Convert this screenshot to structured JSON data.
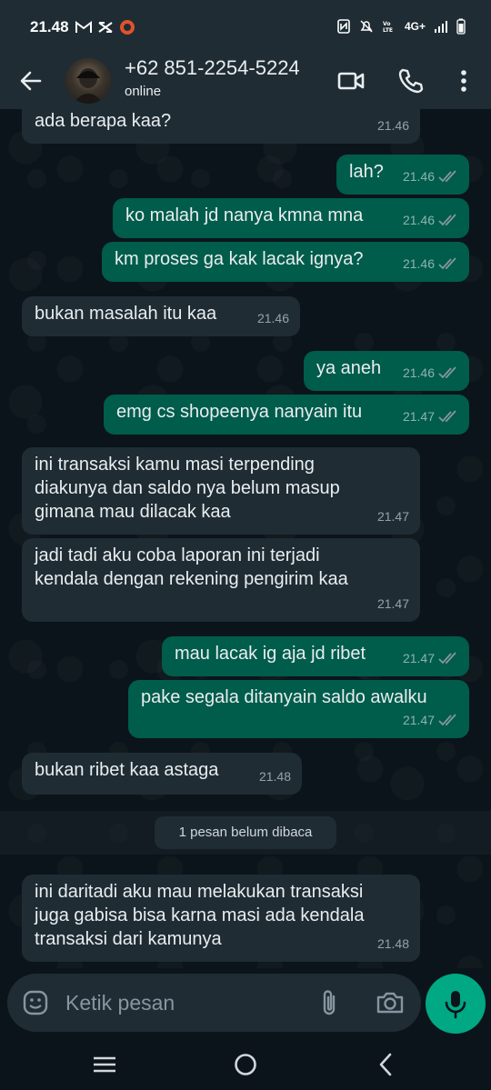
{
  "status_bar": {
    "time": "21.48",
    "network": "4G+"
  },
  "header": {
    "contact_name": "+62 851-2254-5224",
    "contact_status": "online"
  },
  "messages": [
    {
      "dir": "in",
      "text": "ada berapa kaa?",
      "time": "21.46"
    },
    {
      "dir": "out",
      "text": "lah?",
      "time": "21.46"
    },
    {
      "dir": "out",
      "text": "ko malah jd nanya kmna mna",
      "time": "21.46"
    },
    {
      "dir": "out",
      "text": "km proses ga kak lacak ignya?",
      "time": "21.46"
    },
    {
      "dir": "in",
      "text": "bukan masalah itu kaa",
      "time": "21.46"
    },
    {
      "dir": "out",
      "text": "ya aneh",
      "time": "21.46"
    },
    {
      "dir": "out",
      "text": "emg cs shopeenya nanyain itu",
      "time": "21.47"
    },
    {
      "dir": "in",
      "text": "ini transaksi kamu masi terpending\ndiakunya dan saldo nya belum masup\ngimana mau dilacak kaa",
      "time": "21.47"
    },
    {
      "dir": "in",
      "text": "jadi tadi aku coba laporan ini terjadi\nkendala dengan rekening pengirim kaa",
      "time": "21.47"
    },
    {
      "dir": "out",
      "text": "mau lacak ig aja jd ribet",
      "time": "21.47"
    },
    {
      "dir": "out",
      "text": "pake segala ditanyain saldo awalku",
      "time": "21.47"
    },
    {
      "dir": "in",
      "text": "bukan ribet kaa astaga",
      "time": "21.48"
    },
    {
      "dir": "in",
      "text": "ini daritadi aku mau melakukan transaksi\njuga gabisa bisa karna masi ada kendala\ntransaksi dari kamunya",
      "time": "21.48"
    }
  ],
  "unread_label": "1 pesan belum dibaca",
  "composer": {
    "placeholder": "Ketik pesan"
  },
  "colors": {
    "incoming_bubble": "#1f2c34",
    "outgoing_bubble": "#005c4b",
    "accent": "#00a884"
  }
}
